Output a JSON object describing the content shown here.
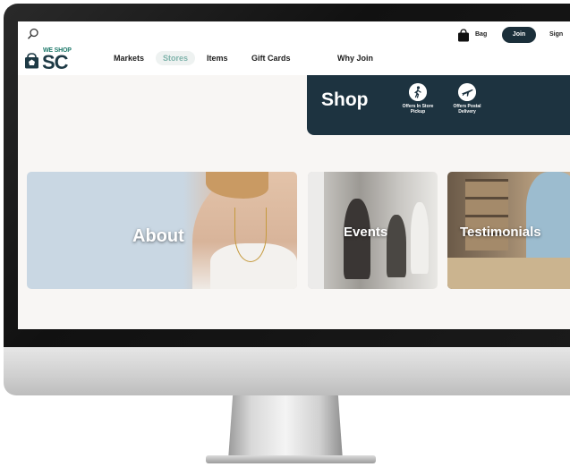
{
  "site": {
    "logo_small": "WE SHOP",
    "logo_big": "SC"
  },
  "header": {
    "bag_label": "Bag",
    "join_label": "Join",
    "signin_label": "Sign"
  },
  "nav": {
    "items": [
      {
        "label": "Markets"
      },
      {
        "label": "Stores"
      },
      {
        "label": "Items"
      },
      {
        "label": "Gift Cards"
      },
      {
        "label": "Why Join"
      }
    ]
  },
  "shop_banner": {
    "title": "Shop",
    "features": [
      {
        "label_line1": "Offers In Store",
        "label_line2": "Pickup",
        "icon": "walking-person-icon"
      },
      {
        "label_line1": "Offers Postal",
        "label_line2": "Delivery",
        "icon": "airplane-icon"
      }
    ]
  },
  "cards": [
    {
      "label": "About"
    },
    {
      "label": "Events"
    },
    {
      "label": "Testimonials"
    }
  ],
  "colors": {
    "brand_dark": "#1d3340",
    "brand_teal": "#1f7a6b",
    "nav_active": "#7fb3ab"
  }
}
